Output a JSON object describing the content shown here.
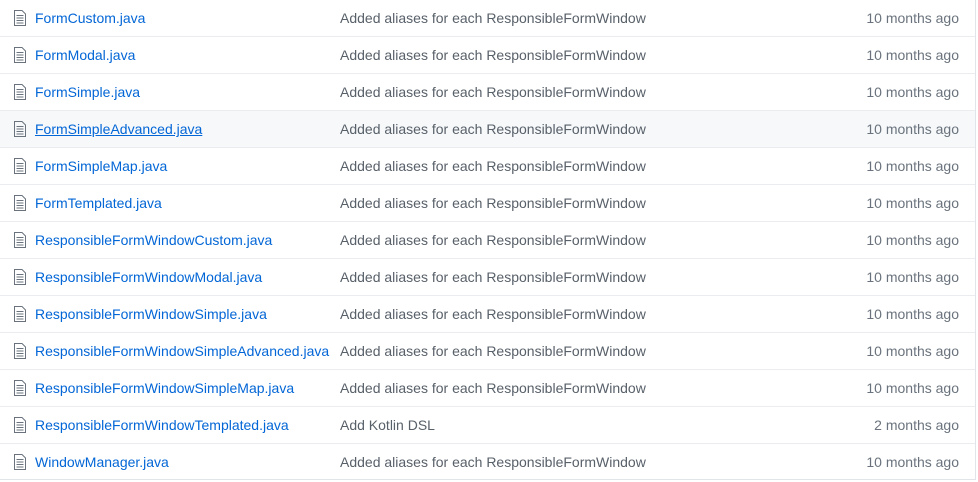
{
  "files": [
    {
      "name": "FormCustom.java",
      "message": "Added aliases for each ResponsibleFormWindow",
      "age": "10 months ago",
      "icon": "file-icon"
    },
    {
      "name": "FormModal.java",
      "message": "Added aliases for each ResponsibleFormWindow",
      "age": "10 months ago",
      "icon": "file-icon"
    },
    {
      "name": "FormSimple.java",
      "message": "Added aliases for each ResponsibleFormWindow",
      "age": "10 months ago",
      "icon": "file-icon"
    },
    {
      "name": "FormSimpleAdvanced.java",
      "message": "Added aliases for each ResponsibleFormWindow",
      "age": "10 months ago",
      "icon": "file-icon",
      "hovered": true
    },
    {
      "name": "FormSimpleMap.java",
      "message": "Added aliases for each ResponsibleFormWindow",
      "age": "10 months ago",
      "icon": "file-icon"
    },
    {
      "name": "FormTemplated.java",
      "message": "Added aliases for each ResponsibleFormWindow",
      "age": "10 months ago",
      "icon": "file-icon"
    },
    {
      "name": "ResponsibleFormWindowCustom.java",
      "message": "Added aliases for each ResponsibleFormWindow",
      "age": "10 months ago",
      "icon": "file-icon"
    },
    {
      "name": "ResponsibleFormWindowModal.java",
      "message": "Added aliases for each ResponsibleFormWindow",
      "age": "10 months ago",
      "icon": "file-icon"
    },
    {
      "name": "ResponsibleFormWindowSimple.java",
      "message": "Added aliases for each ResponsibleFormWindow",
      "age": "10 months ago",
      "icon": "file-icon"
    },
    {
      "name": "ResponsibleFormWindowSimpleAdvanced.java",
      "message": "Added aliases for each ResponsibleFormWindow",
      "age": "10 months ago",
      "icon": "file-icon"
    },
    {
      "name": "ResponsibleFormWindowSimpleMap.java",
      "message": "Added aliases for each ResponsibleFormWindow",
      "age": "10 months ago",
      "icon": "file-icon"
    },
    {
      "name": "ResponsibleFormWindowTemplated.java",
      "message": "Add Kotlin DSL",
      "age": "2 months ago",
      "icon": "file-icon"
    },
    {
      "name": "WindowManager.java",
      "message": "Added aliases for each ResponsibleFormWindow",
      "age": "10 months ago",
      "icon": "file-icon"
    }
  ],
  "colors": {
    "link": "#0366d6",
    "message": "#586069",
    "age": "#6a737d",
    "border": "#eaecef",
    "hover_bg": "#f6f8fa",
    "icon": "#6a737d"
  }
}
